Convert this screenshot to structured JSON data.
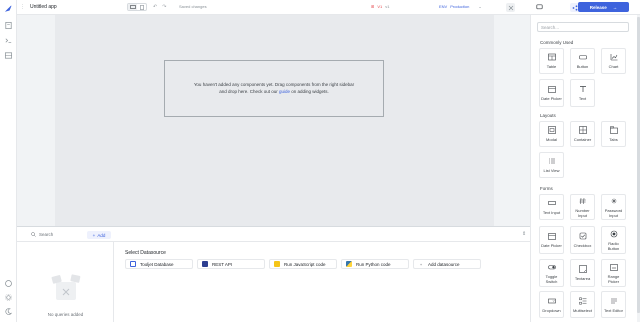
{
  "header": {
    "app_name": "Untitled app",
    "saved_status": "Saved changes",
    "version_name": "V1",
    "version_marker": "v1",
    "env_label": "ENV",
    "env_value": "Production",
    "release_label": "Release"
  },
  "canvas": {
    "empty_line1": "You haven't added any components yet. Drag components from the right sidebar",
    "empty_line2a": "and drop here. Check out our ",
    "empty_link": "guide",
    "empty_line2b": " on adding widgets."
  },
  "query_panel": {
    "search_placeholder": "Search",
    "add_label": "Add",
    "no_queries": "No queries added",
    "select_datasource": "Select Datasource",
    "datasources": [
      "Tooljet Database",
      "REST API",
      "Run JavaScript code",
      "Run Python code",
      "Add datasource"
    ]
  },
  "components": {
    "search_placeholder": "Search...",
    "sections": [
      {
        "title": "Commonly Used",
        "items": [
          "Table",
          "Button",
          "Chart",
          "Date Picker",
          "Text"
        ]
      },
      {
        "title": "Layouts",
        "items": [
          "Modal",
          "Container",
          "Tabs",
          "List View"
        ]
      },
      {
        "title": "Forms",
        "items": [
          "Text Input",
          "Number Input",
          "Password Input",
          "Date Picker",
          "Checkbox",
          "Radio Button",
          "Toggle Switch",
          "Textarea",
          "Range Picker",
          "Dropdown",
          "Multiselect",
          "Text Editor"
        ]
      }
    ]
  },
  "colors": {
    "accent": "#3e63dd",
    "canvas": "#e8eaed",
    "version": "#e5484d"
  }
}
